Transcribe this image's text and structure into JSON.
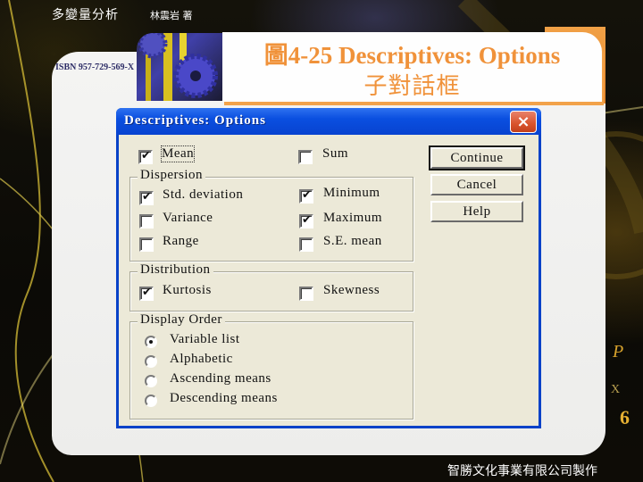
{
  "slide": {
    "book_title": "多變量分析",
    "author": "林震岩 著",
    "isbn": "ISBN 957-729-569-X",
    "figure_title": "圖4-25  Descriptives: Options",
    "figure_subtitle": "子對話框",
    "footer": "智勝文化事業有限公司製作",
    "accent_color": "#f0923a"
  },
  "dialog": {
    "title": "Descriptives: Options",
    "close_icon": "×",
    "top_options": [
      {
        "label": "Mean",
        "checked": true
      },
      {
        "label": "Sum",
        "checked": false
      }
    ],
    "dispersion": {
      "title": "Dispersion",
      "options": [
        {
          "label": "Std. deviation",
          "checked": true
        },
        {
          "label": "Minimum",
          "checked": true
        },
        {
          "label": "Variance",
          "checked": false
        },
        {
          "label": "Maximum",
          "checked": true
        },
        {
          "label": "Range",
          "checked": false
        },
        {
          "label": "S.E. mean",
          "checked": false
        }
      ]
    },
    "distribution": {
      "title": "Distribution",
      "options": [
        {
          "label": "Kurtosis",
          "checked": true
        },
        {
          "label": "Skewness",
          "checked": false
        }
      ]
    },
    "display_order": {
      "title": "Display Order",
      "selected": "Variable list",
      "options": [
        {
          "label": "Variable list",
          "selected": true
        },
        {
          "label": "Alphabetic",
          "selected": false
        },
        {
          "label": "Ascending means",
          "selected": false
        },
        {
          "label": "Descending means",
          "selected": false
        }
      ]
    },
    "buttons": {
      "continue": "Continue",
      "cancel": "Cancel",
      "help": "Help"
    },
    "check_mark": "✔"
  }
}
